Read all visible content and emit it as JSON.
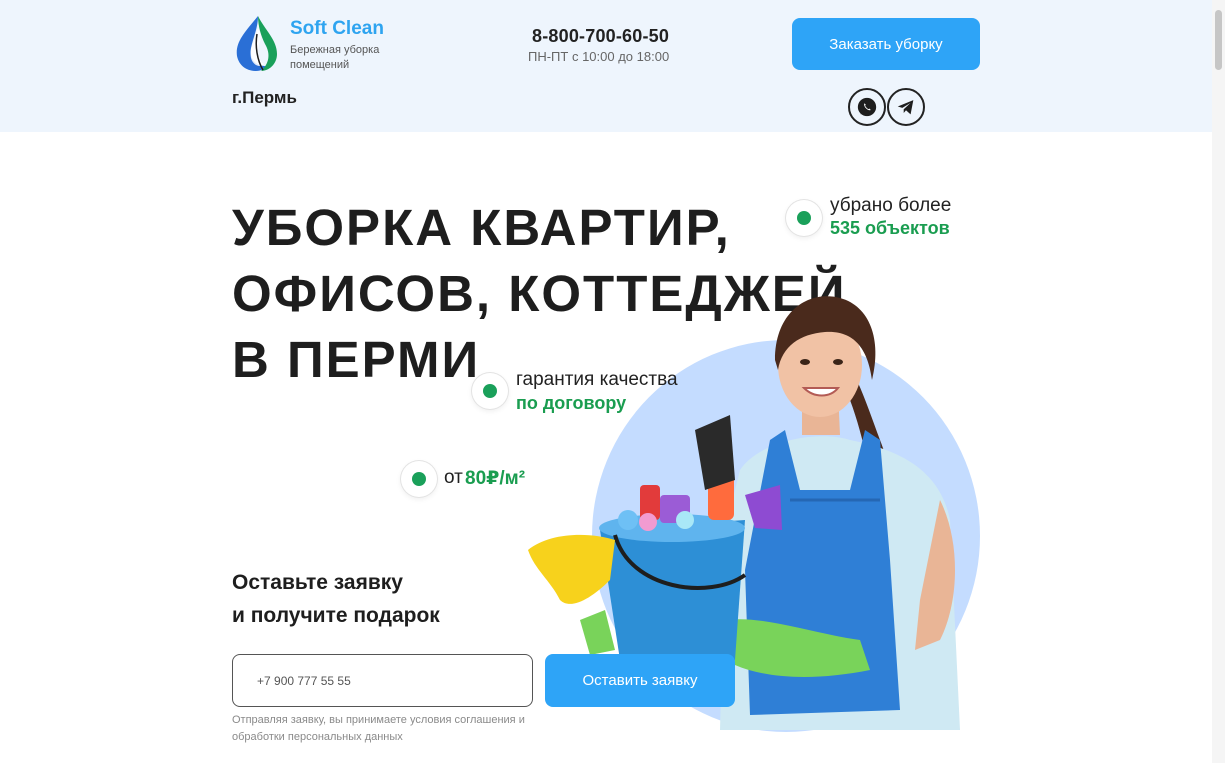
{
  "header": {
    "brand_name": "Soft Clean",
    "brand_tagline": "Бережная уборка помещений",
    "city": "г.Пермь",
    "phone": "8-800-700-60-50",
    "hours": "ПН-ПТ с 10:00 до 18:00",
    "order_button": "Заказать уборку",
    "social": [
      "whatsapp-icon",
      "telegram-icon"
    ]
  },
  "hero": {
    "headline": [
      "УБОРКА КВАРТИР,",
      "ОФИСОВ, КОТТЕДЖЕЙ",
      "В ПЕРМИ"
    ],
    "features": [
      {
        "line1": "убрано более",
        "line2": "535 объектов"
      },
      {
        "line1": "гарантия качества",
        "line2": "по договору"
      }
    ],
    "price": {
      "prefix": "от",
      "value": "80₽/м²"
    }
  },
  "form": {
    "title_line1": "Оставьте заявку",
    "title_line2": "и получите подарок",
    "phone_placeholder": "+7 900 777 55 55",
    "submit": "Оставить заявку",
    "consent": "Отправляя заявку, вы принимаете условия соглашения и обработки персональных данных"
  },
  "colors": {
    "accent_blue": "#2ea4f7",
    "accent_green": "#1a9d50",
    "header_bg": "#eef5fd",
    "photo_bg": "#c4dcff"
  }
}
